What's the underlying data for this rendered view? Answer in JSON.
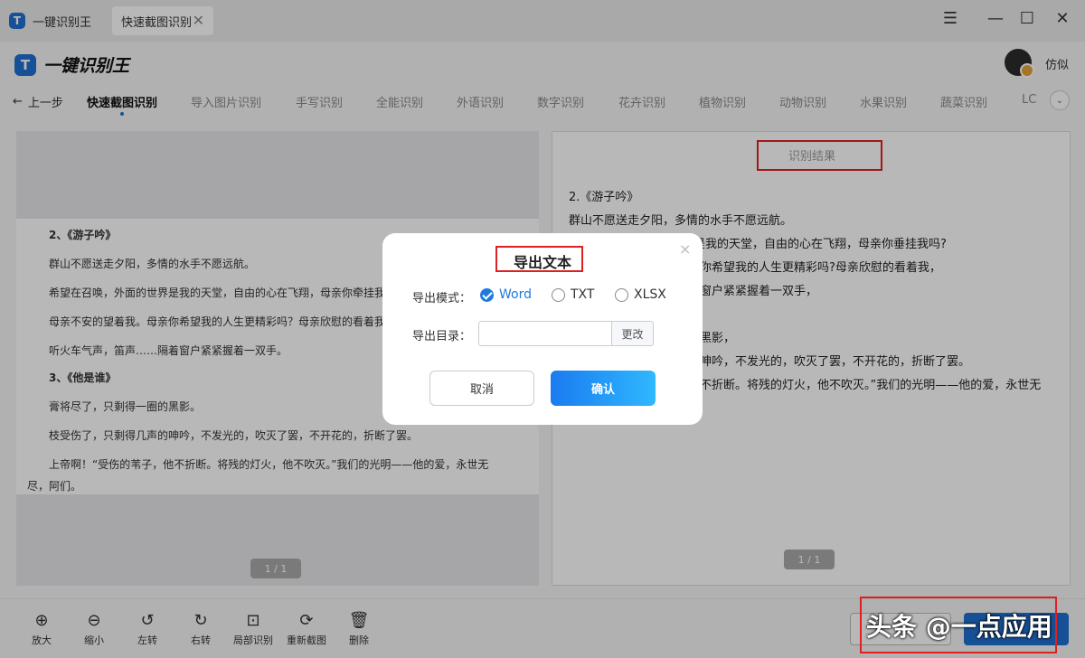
{
  "window": {
    "tabs": [
      "一键识别王",
      "快速截图识别"
    ],
    "controls": {
      "menu": "☰",
      "minimize": "—",
      "maximize": "☐",
      "close": "✕"
    }
  },
  "header": {
    "brand": "一键识别王",
    "username": "仿似"
  },
  "nav": {
    "back": "上一步",
    "tabs": [
      "快速截图识别",
      "导入图片识别",
      "手写识别",
      "全能识别",
      "外语识别",
      "数字识别",
      "花卉识别",
      "植物识别",
      "动物识别",
      "水果识别",
      "蔬菜识别",
      "LC"
    ],
    "active_tab": "快速截图识别"
  },
  "source_doc": {
    "lines": [
      "2、《游子吟》",
      "群山不愿送走夕阳，多情的水手不愿远航。",
      "希望在召唤，外面的世界是我的天堂，自由的心在飞翔，母亲你牵挂我",
      "母亲不安的望着我。母亲你希望我的人生更精彩吗？母亲欣慰的看着我",
      "听火车气声，笛声……隔着窗户紧紧握着一双手。",
      "3、《他是谁》",
      "膏将尽了，只剩得一圈的黑影。",
      "枝受伤了，只剩得几声的呻吟，不发光的，吹灭了罢，不开花的，折断了罢。",
      "上帝啊！“受伤的苇子，他不折断。将残的灯火，他不吹灭。”我们的光明——他的爱，永世无",
      "尽，阿们。"
    ],
    "pager": "1 / 1"
  },
  "result": {
    "title": "识别结果",
    "lines": [
      "2.《游子吟》",
      "群山不愿送走夕阳，多情的水手不愿远航。",
      "是我的天堂，自由的心在飞翔，母亲你垂挂我吗?",
      "你希望我的人生更精彩吗?母亲欣慰的看着我，",
      "窗户紧紧握着一双手，",
      "黑影，",
      "呻吟，不发光的，吹灭了罢，不开花的，折断了罢。",
      "不折断。将残的灯火，他不吹灭。”我们的光明——他的爱，永世无"
    ],
    "pager": "1 / 1"
  },
  "toolbar": {
    "tools": [
      {
        "label": "放大",
        "icon": "zoom-in-icon"
      },
      {
        "label": "缩小",
        "icon": "zoom-out-icon"
      },
      {
        "label": "左转",
        "icon": "rotate-left-icon"
      },
      {
        "label": "右转",
        "icon": "rotate-right-icon"
      },
      {
        "label": "局部识别",
        "icon": "scan-area-icon"
      },
      {
        "label": "重新截图",
        "icon": "refresh-icon"
      },
      {
        "label": "删除",
        "icon": "trash-icon"
      }
    ]
  },
  "watermark": "头条 @一点应用",
  "dialog": {
    "title": "导出文本",
    "close": "×",
    "mode_label": "导出模式：",
    "options": [
      "Word",
      "TXT",
      "XLSX"
    ],
    "selected": "Word",
    "dir_label": "导出目录：",
    "dir_value": "",
    "change_button": "更改",
    "cancel": "取消",
    "confirm": "确认"
  },
  "colors": {
    "accent": "#1f7ae0",
    "highlight_box": "#e02020"
  }
}
